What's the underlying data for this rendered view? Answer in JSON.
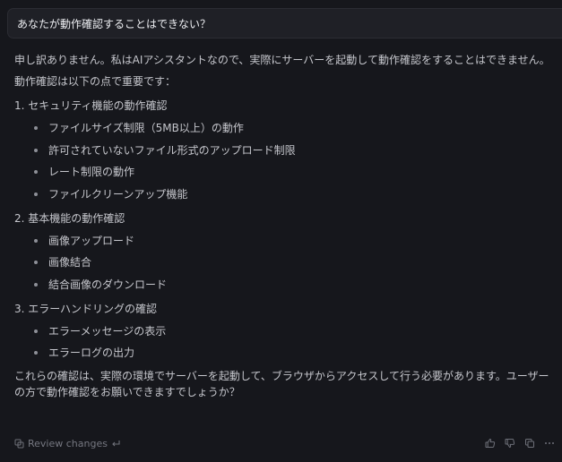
{
  "user_message": "あなたが動作確認することはできない？",
  "assistant": {
    "intro": "申し訳ありません。私はAIアシスタントなので、実際にサーバーを起動して動作確認をすることはできません。",
    "lead": "動作確認は以下の点で重要です：",
    "sections": [
      {
        "heading": "1. セキュリティ機能の動作確認",
        "items": [
          "ファイルサイズ制限（5MB以上）の動作",
          "許可されていないファイル形式のアップロード制限",
          "レート制限の動作",
          "ファイルクリーンアップ機能"
        ]
      },
      {
        "heading": "2. 基本機能の動作確認",
        "items": [
          "画像アップロード",
          "画像結合",
          "結合画像のダウンロード"
        ]
      },
      {
        "heading": "3. エラーハンドリングの確認",
        "items": [
          "エラーメッセージの表示",
          "エラーログの出力"
        ]
      }
    ],
    "closing": "これらの確認は、実際の環境でサーバーを起動して、ブラウザからアクセスして行う必要があります。ユーザーの方で動作確認をお願いできますでしょうか？"
  },
  "footer": {
    "review_label": "Review changes",
    "icons": [
      "review-changes-icon",
      "return-arrow-icon",
      "thumbs-up-icon",
      "thumbs-down-icon",
      "copy-icon",
      "more-icon"
    ]
  }
}
